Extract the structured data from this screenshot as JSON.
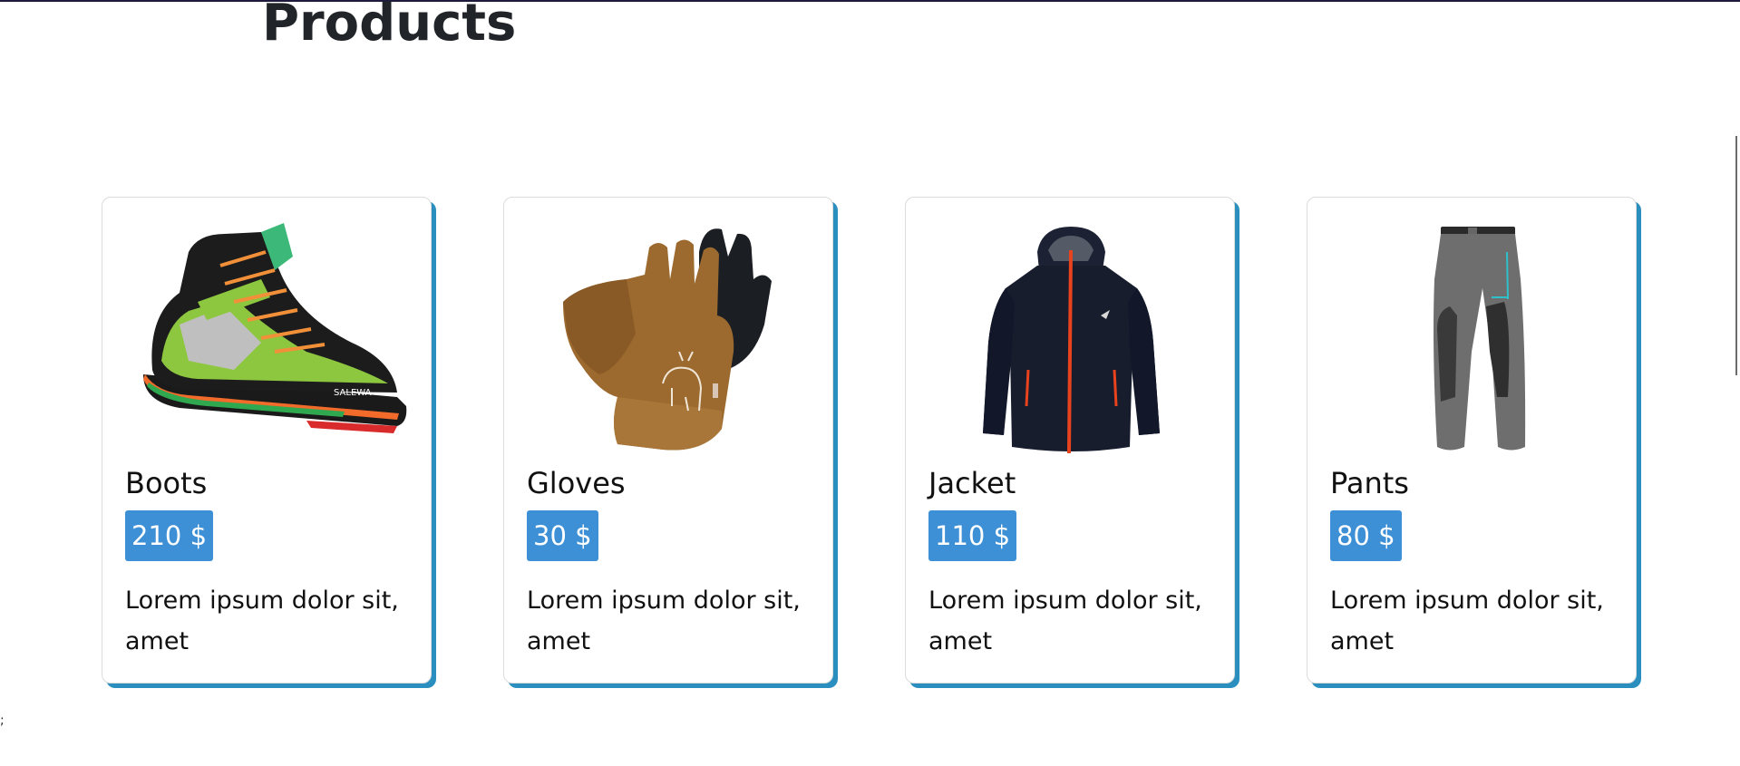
{
  "page": {
    "title": "Products"
  },
  "products": [
    {
      "name": "Boots",
      "price": "210 $",
      "description": "Lorem ipsum dolor sit, amet",
      "image_icon": "hiking-boot-icon"
    },
    {
      "name": "Gloves",
      "price": "30 $",
      "description": "Lorem ipsum dolor sit, amet",
      "image_icon": "gloves-icon"
    },
    {
      "name": "Jacket",
      "price": "110 $",
      "description": "Lorem ipsum dolor sit, amet",
      "image_icon": "jacket-icon"
    },
    {
      "name": "Pants",
      "price": "80 $",
      "description": "Lorem ipsum dolor sit, amet",
      "image_icon": "pants-icon"
    }
  ],
  "footer": {
    "stray_text": ";"
  },
  "colors": {
    "card_accent": "#2a8fbf",
    "price_badge": "#3d8fd6",
    "title_text": "#212529"
  }
}
